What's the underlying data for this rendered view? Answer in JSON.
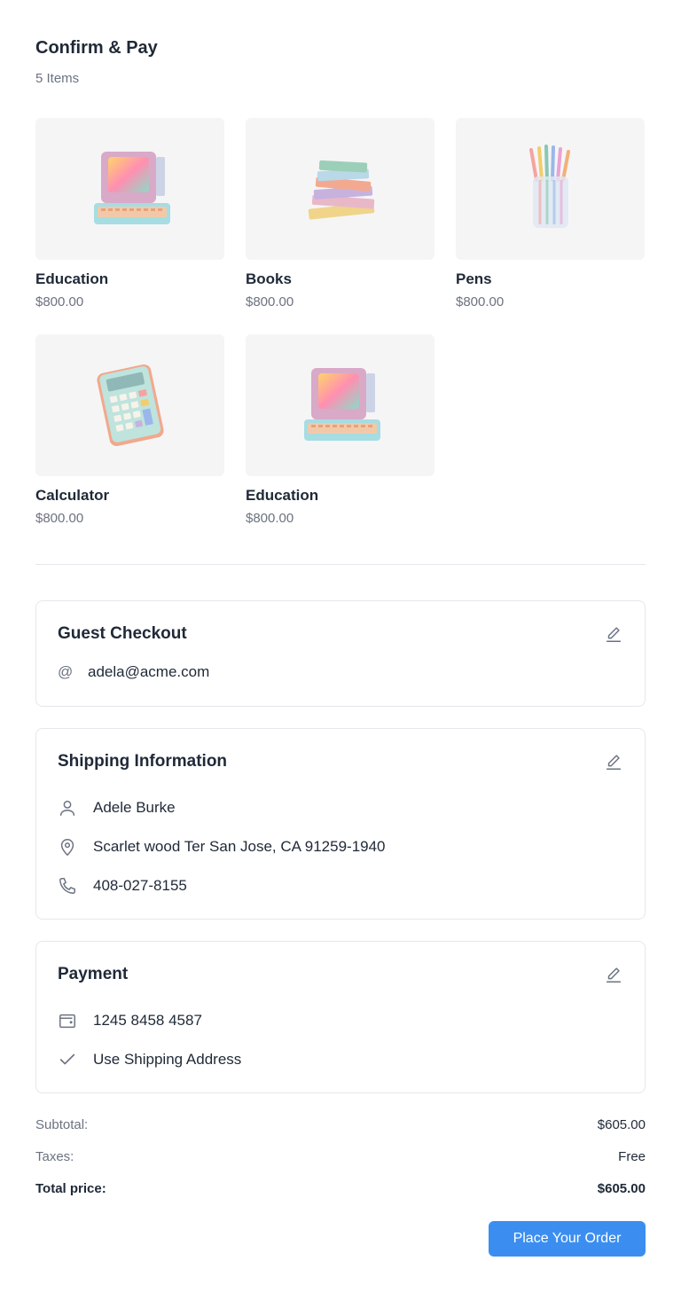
{
  "header": {
    "title": "Confirm & Pay",
    "count": "5 Items"
  },
  "products": [
    {
      "name": "Education",
      "price": "$800.00",
      "image": "retro-computer"
    },
    {
      "name": "Books",
      "price": "$800.00",
      "image": "book-stack"
    },
    {
      "name": "Pens",
      "price": "$800.00",
      "image": "pencil-cup"
    },
    {
      "name": "Calculator",
      "price": "$800.00",
      "image": "calculator"
    },
    {
      "name": "Education",
      "price": "$800.00",
      "image": "retro-computer"
    }
  ],
  "guest": {
    "title": "Guest Checkout",
    "email_icon": "@",
    "email": "adela@acme.com"
  },
  "shipping": {
    "title": "Shipping Information",
    "name": "Adele Burke",
    "address": "Scarlet wood Ter San Jose, CA 91259-1940",
    "phone": "408-027-8155"
  },
  "payment": {
    "title": "Payment",
    "card": "1245 8458 4587",
    "shipping_option": "Use Shipping Address"
  },
  "summary": {
    "subtotal_label": "Subtotal:",
    "subtotal": "$605.00",
    "taxes_label": "Taxes:",
    "taxes": "Free",
    "total_label": "Total price:",
    "total": "$605.00"
  },
  "cta": {
    "label": "Place Your Order",
    "color": "#3b8ef0"
  }
}
